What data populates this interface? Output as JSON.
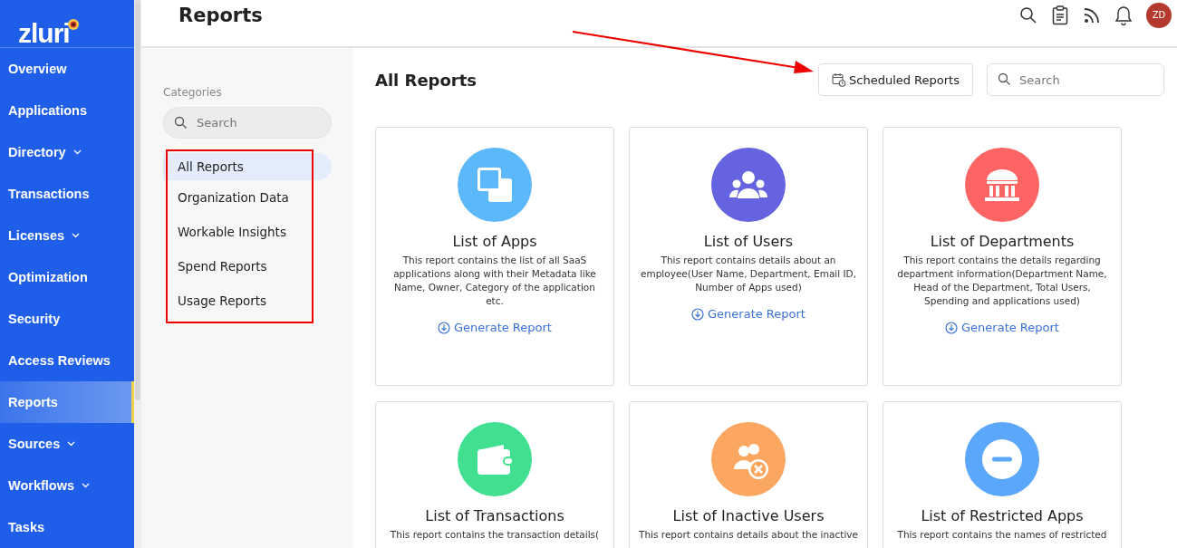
{
  "sidebar": {
    "logo": "zluri",
    "items": [
      {
        "label": "Overview",
        "expandable": false,
        "selected": false
      },
      {
        "label": "Applications",
        "expandable": false,
        "selected": false
      },
      {
        "label": "Directory",
        "expandable": true,
        "selected": false
      },
      {
        "label": "Transactions",
        "expandable": false,
        "selected": false
      },
      {
        "label": "Licenses",
        "expandable": true,
        "selected": false
      },
      {
        "label": "Optimization",
        "expandable": false,
        "selected": false
      },
      {
        "label": "Security",
        "expandable": false,
        "selected": false
      },
      {
        "label": "Access Reviews",
        "expandable": false,
        "selected": false
      },
      {
        "label": "Reports",
        "expandable": false,
        "selected": true
      },
      {
        "label": "Sources",
        "expandable": true,
        "selected": false
      },
      {
        "label": "Workflows",
        "expandable": true,
        "selected": false
      },
      {
        "label": "Tasks",
        "expandable": false,
        "selected": false
      }
    ]
  },
  "header": {
    "title": "Reports",
    "avatar": "ZD"
  },
  "categories": {
    "heading": "Categories",
    "search": {
      "placeholder": "Search"
    },
    "items": [
      {
        "label": "All Reports",
        "selected": true
      },
      {
        "label": "Organization Data",
        "selected": false
      },
      {
        "label": "Workable Insights",
        "selected": false
      },
      {
        "label": "Spend Reports",
        "selected": false
      },
      {
        "label": "Usage Reports",
        "selected": false
      }
    ]
  },
  "main": {
    "title": "All Reports",
    "scheduled_button": "Scheduled Reports",
    "search": {
      "placeholder": "Search"
    },
    "cards": [
      {
        "kind": "apps",
        "color": "#5ab8fb",
        "title": "List of Apps",
        "description": "This report contains the list of all SaaS applications along with their Metadata like Name, Owner, Category of the application etc.",
        "action": "Generate Report"
      },
      {
        "kind": "users",
        "color": "#6563df",
        "title": "List of Users",
        "description": "This report contains details about an employee(User Name, Department, Email ID, Number of Apps used)",
        "action": "Generate Report"
      },
      {
        "kind": "departments",
        "color": "#fd6565",
        "title": "List of Departments",
        "description": "This report contains the details regarding department information(Department Name, Head of the Department, Total Users, Spending and applications used)",
        "action": "Generate Report"
      },
      {
        "kind": "transactions",
        "color": "#40e090",
        "title": "List of Transactions",
        "description": "This report contains the transaction details("
      },
      {
        "kind": "inactive",
        "color": "#fba761",
        "title": "List of Inactive Users",
        "description": "This report contains details about the inactive"
      },
      {
        "kind": "restricted",
        "color": "#5aa7fb",
        "title": "List of Restricted Apps",
        "description": "This report contains the names of restricted"
      }
    ]
  }
}
